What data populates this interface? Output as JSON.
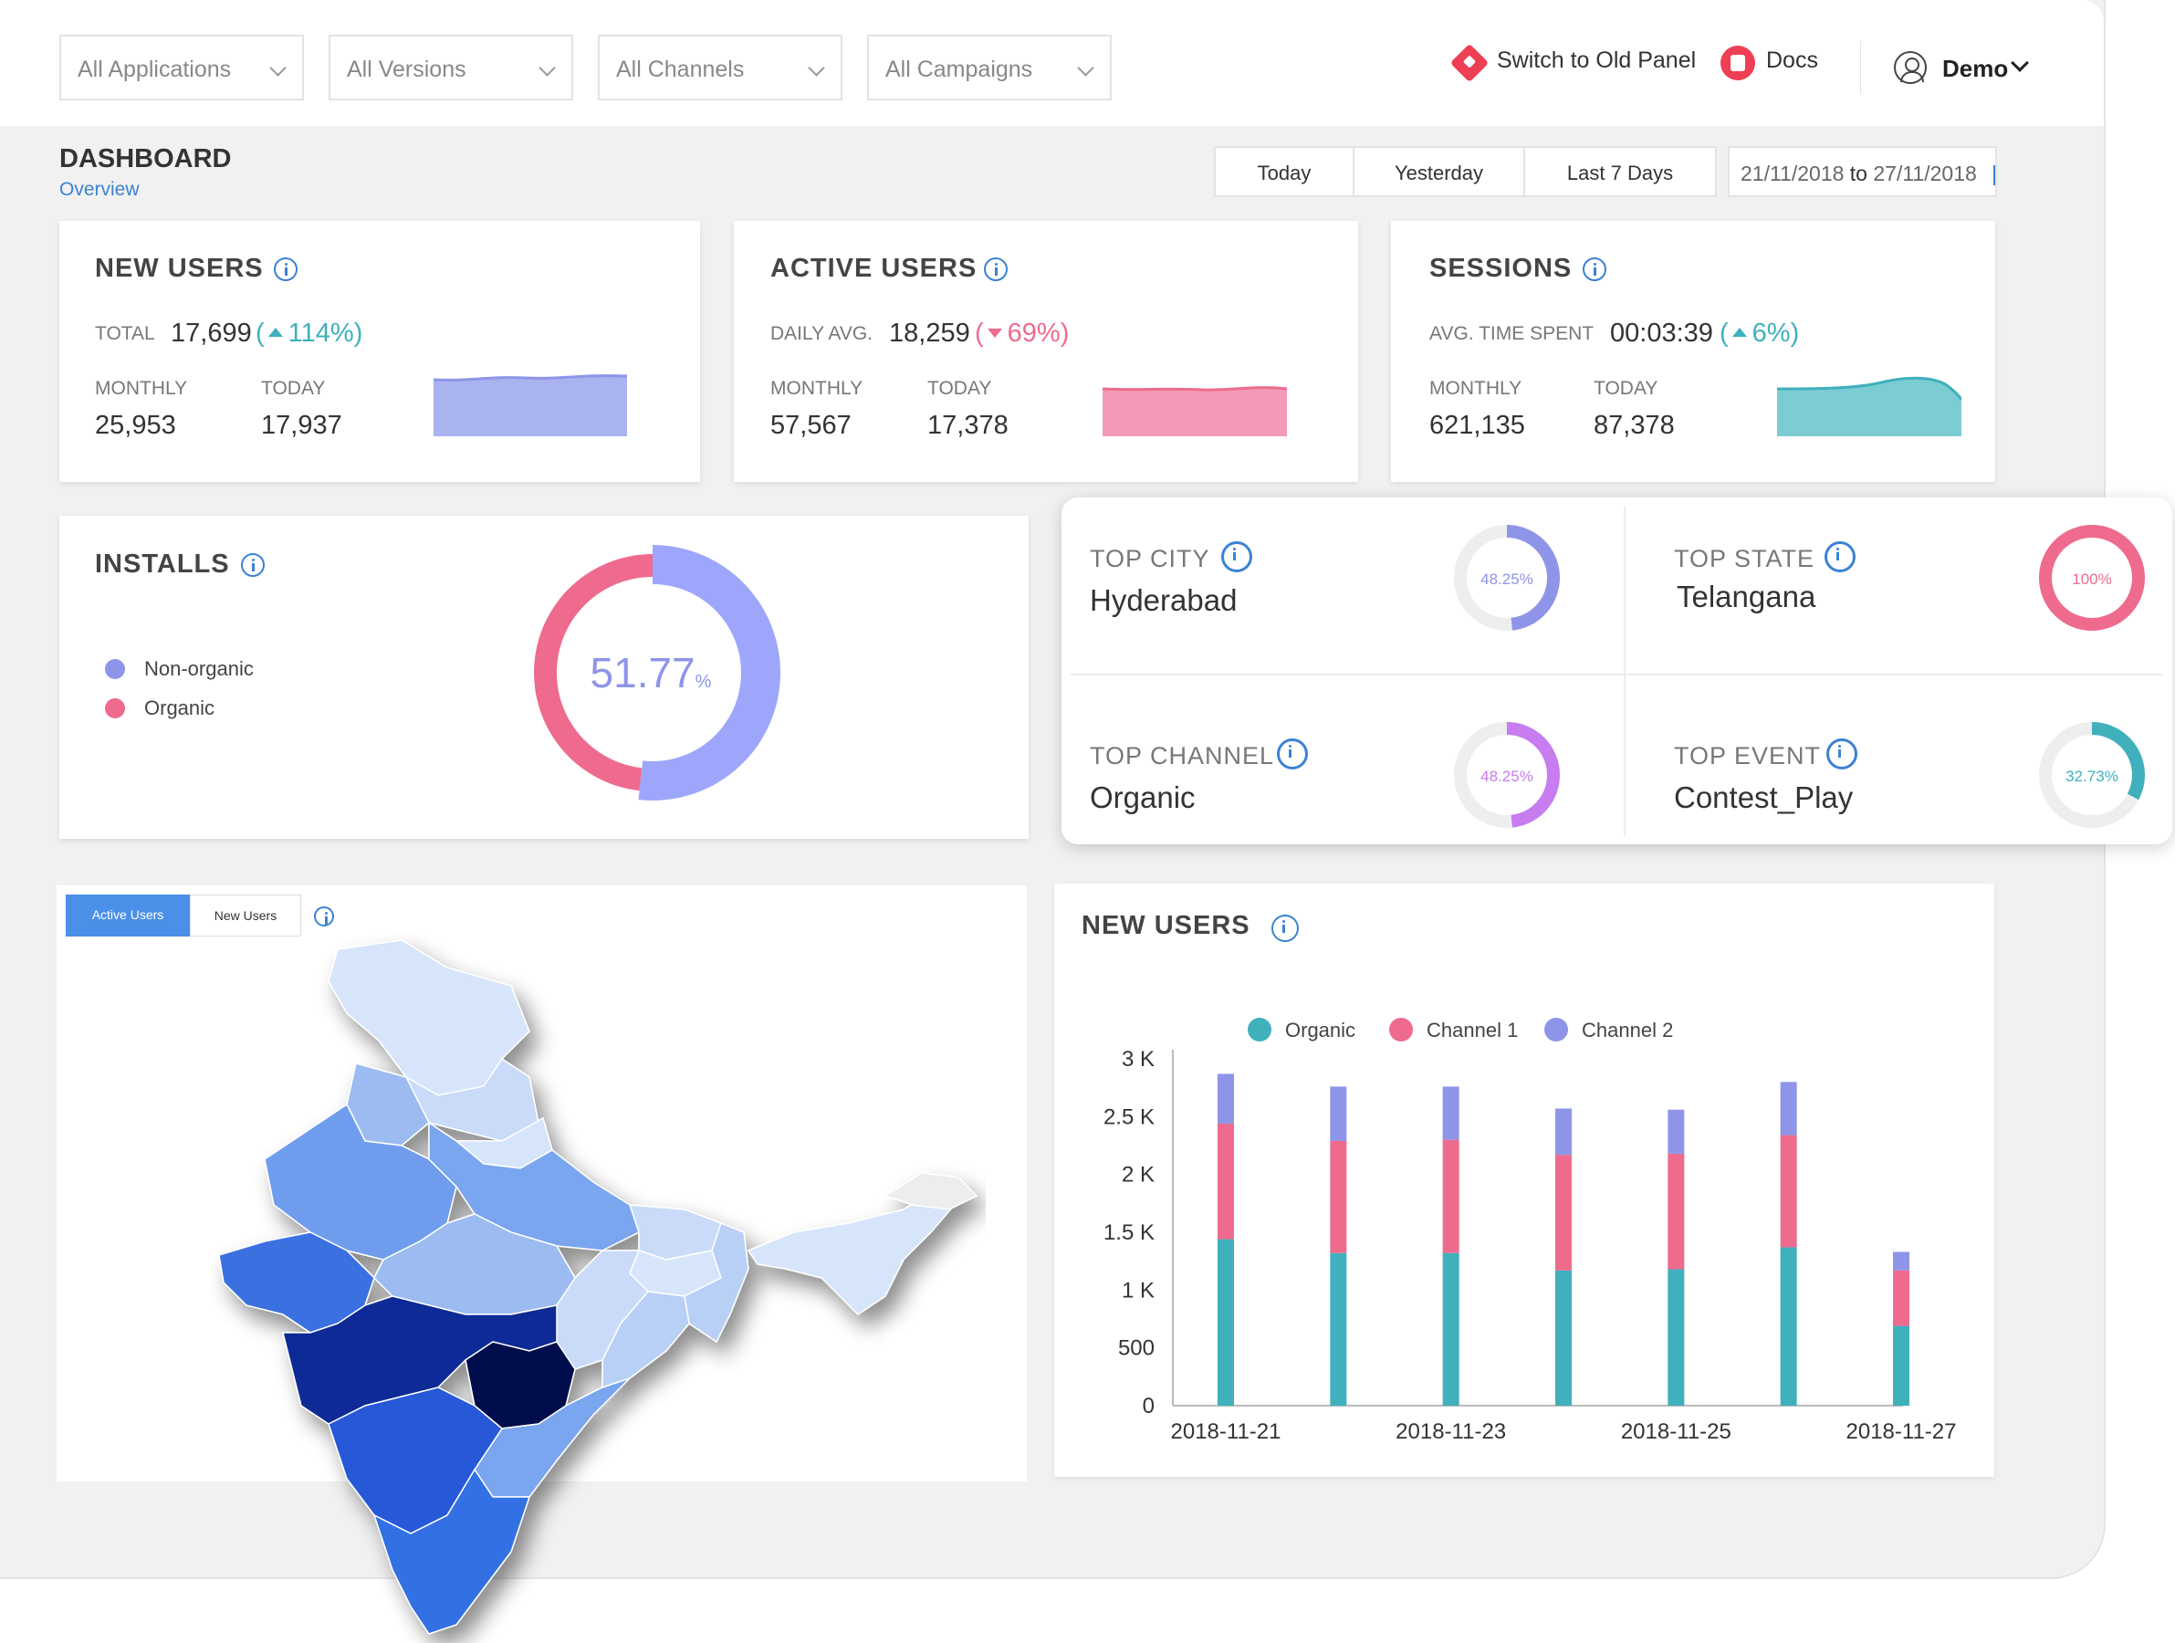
{
  "filters": [
    {
      "label": "All Applications"
    },
    {
      "label": "All Versions"
    },
    {
      "label": "All Channels"
    },
    {
      "label": "All Campaigns"
    }
  ],
  "topnav": {
    "switch_label": "Switch to Old Panel",
    "docs_label": "Docs",
    "user_label": "Demo"
  },
  "page": {
    "title": "DASHBOARD",
    "subtitle": "Overview"
  },
  "date_range": {
    "buttons": [
      "Today",
      "Yesterday",
      "Last 7 Days"
    ],
    "from": "21/11/2018",
    "to_word": "to",
    "to": "27/11/2018"
  },
  "stats": {
    "new_users": {
      "title": "NEW USERS",
      "total_label": "TOTAL",
      "total_value": "17,699",
      "change": "114%",
      "change_dir": "up",
      "monthly_label": "MONTHLY",
      "monthly_value": "25,953",
      "today_label": "TODAY",
      "today_value": "17,937",
      "color": "#a9b3ef"
    },
    "active_users": {
      "title": "ACTIVE USERS",
      "total_label": "DAILY AVG.",
      "total_value": "18,259",
      "change": "69%",
      "change_dir": "down",
      "monthly_label": "MONTHLY",
      "monthly_value": "57,567",
      "today_label": "TODAY",
      "today_value": "17,378",
      "color": "#f39ab6"
    },
    "sessions": {
      "title": "SESSIONS",
      "total_label": "AVG. TIME SPENT",
      "total_value": "00:03:39",
      "change": "6%",
      "change_dir": "up",
      "monthly_label": "MONTHLY",
      "monthly_value": "621,135",
      "today_label": "TODAY",
      "today_value": "87,378",
      "color": "#7cccd4"
    }
  },
  "installs": {
    "title": "INSTALLS",
    "center_value": "51.77",
    "center_unit": "%",
    "legend": [
      {
        "name": "Non-organic",
        "color": "#8e95e8"
      },
      {
        "name": "Organic",
        "color": "#ee6b8e"
      }
    ],
    "non_organic_pct": 51.77
  },
  "top_stats": [
    {
      "label": "TOP CITY",
      "value": "Hyderabad",
      "pct_text": "48.25%",
      "pct": 48.25,
      "color": "#8e95e8"
    },
    {
      "label": "TOP STATE",
      "value": "Telangana",
      "pct_text": "100%",
      "pct": 100,
      "color": "#ee6b8e"
    },
    {
      "label": "TOP CHANNEL",
      "value": "Organic",
      "pct_text": "48.25%",
      "pct": 48.25,
      "color": "#c77cf0"
    },
    {
      "label": "TOP EVENT",
      "value": "Contest_Play",
      "pct_text": "32.73%",
      "pct": 32.73,
      "color": "#3fb0bc"
    }
  ],
  "map": {
    "tabs": [
      "Active Users",
      "New Users"
    ],
    "active_tab": "Active Users"
  },
  "chart_data": {
    "type": "bar",
    "stacked": true,
    "title": "NEW USERS",
    "categories": [
      "2018-11-21",
      "2018-11-22",
      "2018-11-23",
      "2018-11-24",
      "2018-11-25",
      "2018-11-26",
      "2018-11-27"
    ],
    "x_tick_labels": [
      "2018-11-21",
      "2018-11-23",
      "2018-11-25",
      "2018-11-27"
    ],
    "y_tick_labels": [
      "0",
      "500",
      "1 K",
      "1.5 K",
      "2 K",
      "2.5 K",
      "3 K"
    ],
    "ylim": [
      0,
      3000
    ],
    "legend_position": "top",
    "series": [
      {
        "name": "Organic",
        "color": "#3fb0bc",
        "values": [
          1440,
          1320,
          1320,
          1170,
          1180,
          1370,
          690
        ]
      },
      {
        "name": "Channel 1",
        "color": "#ee6b8e",
        "values": [
          1000,
          970,
          980,
          1000,
          1000,
          970,
          480
        ]
      },
      {
        "name": "Channel 2",
        "color": "#8e95e8",
        "values": [
          430,
          470,
          460,
          400,
          380,
          460,
          160
        ]
      }
    ]
  }
}
